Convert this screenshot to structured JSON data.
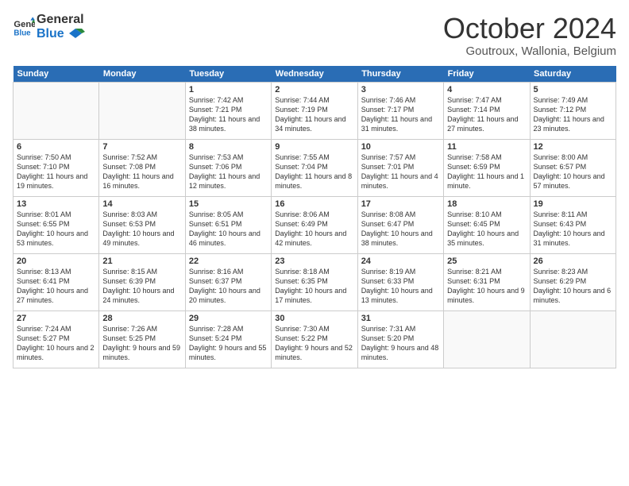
{
  "header": {
    "logo_line1": "General",
    "logo_line2": "Blue",
    "month": "October 2024",
    "location": "Goutroux, Wallonia, Belgium"
  },
  "days_of_week": [
    "Sunday",
    "Monday",
    "Tuesday",
    "Wednesday",
    "Thursday",
    "Friday",
    "Saturday"
  ],
  "weeks": [
    [
      {
        "day": "",
        "info": ""
      },
      {
        "day": "",
        "info": ""
      },
      {
        "day": "1",
        "info": "Sunrise: 7:42 AM\nSunset: 7:21 PM\nDaylight: 11 hours and 38 minutes."
      },
      {
        "day": "2",
        "info": "Sunrise: 7:44 AM\nSunset: 7:19 PM\nDaylight: 11 hours and 34 minutes."
      },
      {
        "day": "3",
        "info": "Sunrise: 7:46 AM\nSunset: 7:17 PM\nDaylight: 11 hours and 31 minutes."
      },
      {
        "day": "4",
        "info": "Sunrise: 7:47 AM\nSunset: 7:14 PM\nDaylight: 11 hours and 27 minutes."
      },
      {
        "day": "5",
        "info": "Sunrise: 7:49 AM\nSunset: 7:12 PM\nDaylight: 11 hours and 23 minutes."
      }
    ],
    [
      {
        "day": "6",
        "info": "Sunrise: 7:50 AM\nSunset: 7:10 PM\nDaylight: 11 hours and 19 minutes."
      },
      {
        "day": "7",
        "info": "Sunrise: 7:52 AM\nSunset: 7:08 PM\nDaylight: 11 hours and 16 minutes."
      },
      {
        "day": "8",
        "info": "Sunrise: 7:53 AM\nSunset: 7:06 PM\nDaylight: 11 hours and 12 minutes."
      },
      {
        "day": "9",
        "info": "Sunrise: 7:55 AM\nSunset: 7:04 PM\nDaylight: 11 hours and 8 minutes."
      },
      {
        "day": "10",
        "info": "Sunrise: 7:57 AM\nSunset: 7:01 PM\nDaylight: 11 hours and 4 minutes."
      },
      {
        "day": "11",
        "info": "Sunrise: 7:58 AM\nSunset: 6:59 PM\nDaylight: 11 hours and 1 minute."
      },
      {
        "day": "12",
        "info": "Sunrise: 8:00 AM\nSunset: 6:57 PM\nDaylight: 10 hours and 57 minutes."
      }
    ],
    [
      {
        "day": "13",
        "info": "Sunrise: 8:01 AM\nSunset: 6:55 PM\nDaylight: 10 hours and 53 minutes."
      },
      {
        "day": "14",
        "info": "Sunrise: 8:03 AM\nSunset: 6:53 PM\nDaylight: 10 hours and 49 minutes."
      },
      {
        "day": "15",
        "info": "Sunrise: 8:05 AM\nSunset: 6:51 PM\nDaylight: 10 hours and 46 minutes."
      },
      {
        "day": "16",
        "info": "Sunrise: 8:06 AM\nSunset: 6:49 PM\nDaylight: 10 hours and 42 minutes."
      },
      {
        "day": "17",
        "info": "Sunrise: 8:08 AM\nSunset: 6:47 PM\nDaylight: 10 hours and 38 minutes."
      },
      {
        "day": "18",
        "info": "Sunrise: 8:10 AM\nSunset: 6:45 PM\nDaylight: 10 hours and 35 minutes."
      },
      {
        "day": "19",
        "info": "Sunrise: 8:11 AM\nSunset: 6:43 PM\nDaylight: 10 hours and 31 minutes."
      }
    ],
    [
      {
        "day": "20",
        "info": "Sunrise: 8:13 AM\nSunset: 6:41 PM\nDaylight: 10 hours and 27 minutes."
      },
      {
        "day": "21",
        "info": "Sunrise: 8:15 AM\nSunset: 6:39 PM\nDaylight: 10 hours and 24 minutes."
      },
      {
        "day": "22",
        "info": "Sunrise: 8:16 AM\nSunset: 6:37 PM\nDaylight: 10 hours and 20 minutes."
      },
      {
        "day": "23",
        "info": "Sunrise: 8:18 AM\nSunset: 6:35 PM\nDaylight: 10 hours and 17 minutes."
      },
      {
        "day": "24",
        "info": "Sunrise: 8:19 AM\nSunset: 6:33 PM\nDaylight: 10 hours and 13 minutes."
      },
      {
        "day": "25",
        "info": "Sunrise: 8:21 AM\nSunset: 6:31 PM\nDaylight: 10 hours and 9 minutes."
      },
      {
        "day": "26",
        "info": "Sunrise: 8:23 AM\nSunset: 6:29 PM\nDaylight: 10 hours and 6 minutes."
      }
    ],
    [
      {
        "day": "27",
        "info": "Sunrise: 7:24 AM\nSunset: 5:27 PM\nDaylight: 10 hours and 2 minutes."
      },
      {
        "day": "28",
        "info": "Sunrise: 7:26 AM\nSunset: 5:25 PM\nDaylight: 9 hours and 59 minutes."
      },
      {
        "day": "29",
        "info": "Sunrise: 7:28 AM\nSunset: 5:24 PM\nDaylight: 9 hours and 55 minutes."
      },
      {
        "day": "30",
        "info": "Sunrise: 7:30 AM\nSunset: 5:22 PM\nDaylight: 9 hours and 52 minutes."
      },
      {
        "day": "31",
        "info": "Sunrise: 7:31 AM\nSunset: 5:20 PM\nDaylight: 9 hours and 48 minutes."
      },
      {
        "day": "",
        "info": ""
      },
      {
        "day": "",
        "info": ""
      }
    ]
  ]
}
